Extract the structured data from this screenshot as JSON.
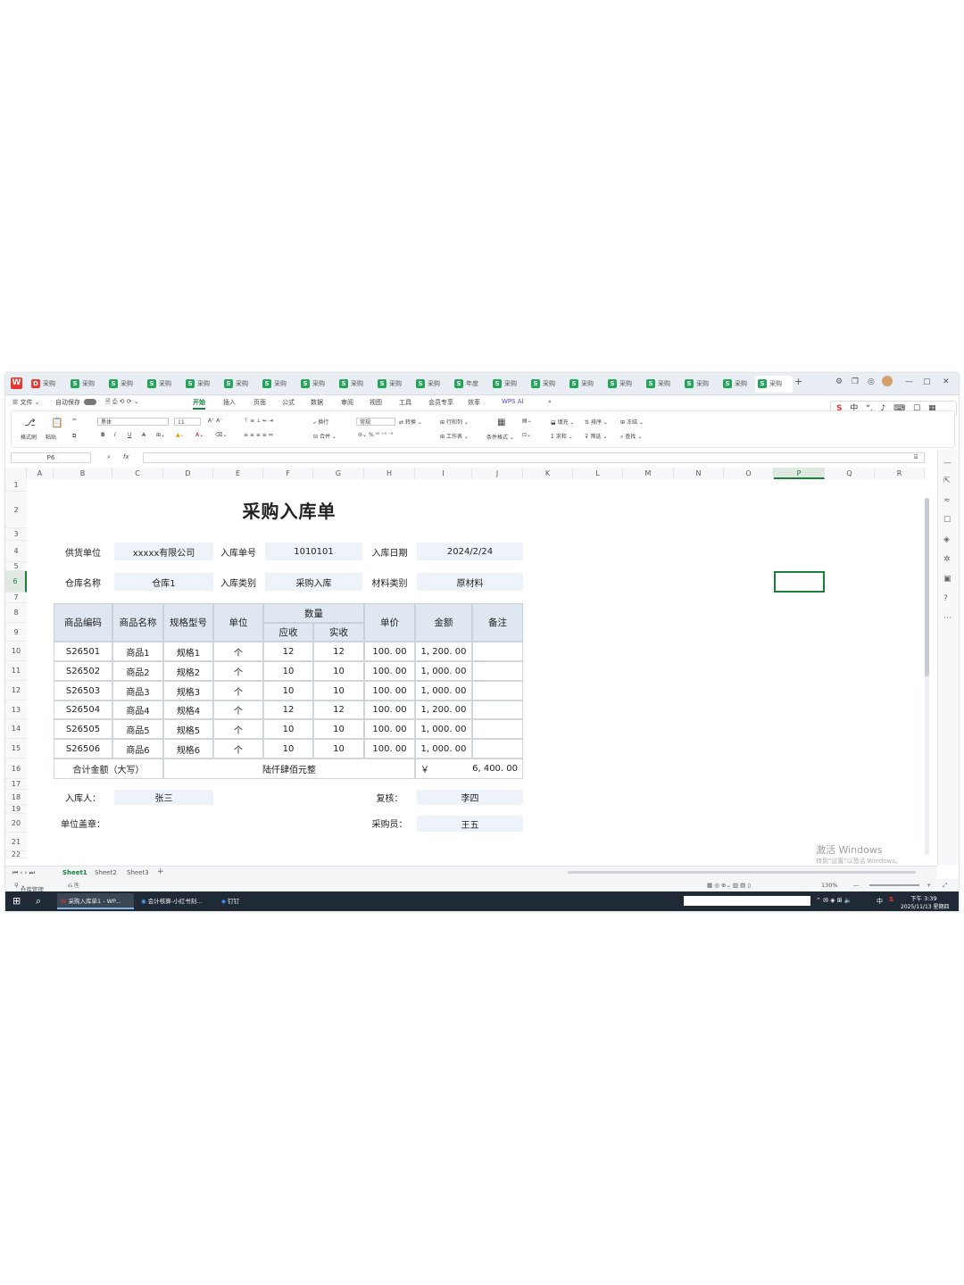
{
  "window": {
    "tabs": [
      "采购",
      "采购",
      "采购",
      "采购",
      "采购",
      "采购",
      "采购",
      "采购",
      "采购",
      "采购",
      "采购",
      "年度",
      "采购",
      "采购",
      "采购",
      "采购",
      "采购",
      "采购",
      "采购",
      "采购"
    ],
    "tab_active_index": 19,
    "tab_letter": "S",
    "new_tab": "+"
  },
  "menu": {
    "file": "文件",
    "autosave": "自动保存",
    "items": [
      "开始",
      "插入",
      "页面",
      "公式",
      "数据",
      "审阅",
      "视图",
      "工具",
      "会员专享",
      "效率",
      "WPS AI"
    ],
    "active": "开始"
  },
  "ime_bar": {
    "label": "中"
  },
  "ribbon": {
    "format_painter": "格式刷",
    "paste": "粘贴",
    "font_name": "黑体",
    "font_size": "11",
    "wrap": "换行",
    "merge": "合并",
    "number_format": "常规",
    "convert": "转换",
    "rows_cols": "行和列",
    "worksheet": "工作表",
    "conditional": "条件格式",
    "fill": "填充",
    "sort": "排序",
    "freeze": "冻结",
    "sum": "求和",
    "filter": "筛选",
    "find": "查找"
  },
  "formula_bar": {
    "name_box": "P6",
    "fx": "fx",
    "value": ""
  },
  "columns": [
    "A",
    "B",
    "C",
    "D",
    "E",
    "F",
    "G",
    "H",
    "I",
    "J",
    "K",
    "L",
    "M",
    "N",
    "O",
    "P",
    "Q",
    "R"
  ],
  "selected_column": "P",
  "rows": [
    "1",
    "2",
    "3",
    "4",
    "5",
    "6",
    "7",
    "8",
    "9",
    "10",
    "11",
    "12",
    "13",
    "14",
    "15",
    "16",
    "17",
    "18",
    "19",
    "20",
    "21",
    "22"
  ],
  "selected_row": "6",
  "sheet": {
    "title": "采购入库单",
    "supplier_label": "供货单位",
    "supplier": "xxxxx有限公司",
    "receipt_no_label": "入库单号",
    "receipt_no": "1010101",
    "receipt_date_label": "入库日期",
    "receipt_date": "2024/2/24",
    "warehouse_label": "仓库名称",
    "warehouse": "仓库1",
    "receipt_type_label": "入库类别",
    "receipt_type": "采购入库",
    "material_type_label": "材料类别",
    "material_type": "原材料",
    "headers": {
      "code": "商品编码",
      "name": "商品名称",
      "spec": "规格型号",
      "unit": "单位",
      "qty": "数量",
      "qty_due": "应收",
      "qty_recv": "实收",
      "price": "单价",
      "amount": "金额",
      "remark": "备注"
    },
    "items": [
      {
        "code": "S26501",
        "name": "商品1",
        "spec": "规格1",
        "unit": "个",
        "due": "12",
        "recv": "12",
        "price": "100. 00",
        "amount": "1, 200. 00",
        "remark": ""
      },
      {
        "code": "S26502",
        "name": "商品2",
        "spec": "规格2",
        "unit": "个",
        "due": "10",
        "recv": "10",
        "price": "100. 00",
        "amount": "1, 000. 00",
        "remark": ""
      },
      {
        "code": "S26503",
        "name": "商品3",
        "spec": "规格3",
        "unit": "个",
        "due": "10",
        "recv": "10",
        "price": "100. 00",
        "amount": "1, 000. 00",
        "remark": ""
      },
      {
        "code": "S26504",
        "name": "商品4",
        "spec": "规格4",
        "unit": "个",
        "due": "12",
        "recv": "12",
        "price": "100. 00",
        "amount": "1, 200. 00",
        "remark": ""
      },
      {
        "code": "S26505",
        "name": "商品5",
        "spec": "规格5",
        "unit": "个",
        "due": "10",
        "recv": "10",
        "price": "100. 00",
        "amount": "1, 000. 00",
        "remark": ""
      },
      {
        "code": "S26506",
        "name": "商品6",
        "spec": "规格6",
        "unit": "个",
        "due": "10",
        "recv": "10",
        "price": "100. 00",
        "amount": "1, 000. 00",
        "remark": ""
      }
    ],
    "total_label": "合计金额（大写）",
    "total_words": "陆仟肆佰元整",
    "currency": "￥",
    "total": "6, 400. 00",
    "receiver_label": "入库人：",
    "receiver": "张三",
    "reviewer_label": "复核：",
    "reviewer": "李四",
    "seal_label": "单位盖章：",
    "buyer_label": "采购员：",
    "buyer": "王五"
  },
  "watermark": {
    "line1": "激活 Windows",
    "line2": "转到\"设置\"以激活 Windows。"
  },
  "sheet_tabs": [
    "Sheet1",
    "Sheet2",
    "Sheet3"
  ],
  "active_sheet": "Sheet1",
  "add_sheet": "+",
  "status": {
    "left": "仓库管理",
    "zoom": "130%"
  },
  "taskbar": {
    "apps": [
      "采购入库单1 - WP...",
      "会计核算-小红书刻...",
      "钉钉"
    ],
    "ime": "中",
    "time": "下午 3:39",
    "date": "2025/11/13 星期四"
  },
  "colors": {
    "accent": "#1a7f3e",
    "header_fill": "#dfe8f1",
    "shade_fill": "#edf3f8",
    "wps_red": "#e53935"
  }
}
